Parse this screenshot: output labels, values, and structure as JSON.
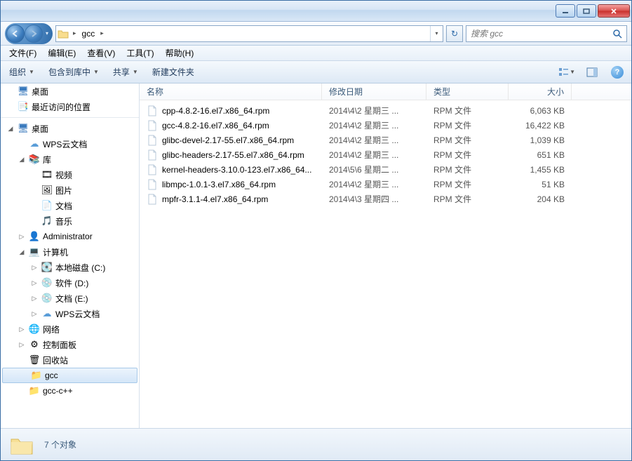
{
  "window": {
    "title_path": "gcc"
  },
  "nav": {
    "address_root_arrow": "▸",
    "address_current": "gcc"
  },
  "search": {
    "placeholder": "搜索 gcc"
  },
  "menus": {
    "file": "文件(F)",
    "edit": "编辑(E)",
    "view": "查看(V)",
    "tools": "工具(T)",
    "help": "帮助(H)"
  },
  "toolbar": {
    "organize": "组织",
    "include": "包含到库中",
    "share": "共享",
    "new_folder": "新建文件夹"
  },
  "columns": {
    "name": "名称",
    "date": "修改日期",
    "type": "类型",
    "size": "大小"
  },
  "sidebar": {
    "desktop1": "桌面",
    "recent": "最近访问的位置",
    "desktop2": "桌面",
    "wps": "WPS云文档",
    "libraries": "库",
    "videos": "视频",
    "pictures": "图片",
    "documents": "文档",
    "music": "音乐",
    "admin": "Administrator",
    "computer": "计算机",
    "drive_c": "本地磁盘 (C:)",
    "drive_d": "软件 (D:)",
    "drive_e": "文档 (E:)",
    "wps2": "WPS云文档",
    "network": "网络",
    "control": "控制面板",
    "recycle": "回收站",
    "gcc": "gcc",
    "gccpp": "gcc-c++"
  },
  "files": [
    {
      "name": "cpp-4.8.2-16.el7.x86_64.rpm",
      "date": "2014\\4\\2 星期三 ...",
      "type": "RPM 文件",
      "size": "6,063 KB"
    },
    {
      "name": "gcc-4.8.2-16.el7.x86_64.rpm",
      "date": "2014\\4\\2 星期三 ...",
      "type": "RPM 文件",
      "size": "16,422 KB"
    },
    {
      "name": "glibc-devel-2.17-55.el7.x86_64.rpm",
      "date": "2014\\4\\2 星期三 ...",
      "type": "RPM 文件",
      "size": "1,039 KB"
    },
    {
      "name": "glibc-headers-2.17-55.el7.x86_64.rpm",
      "date": "2014\\4\\2 星期三 ...",
      "type": "RPM 文件",
      "size": "651 KB"
    },
    {
      "name": "kernel-headers-3.10.0-123.el7.x86_64...",
      "date": "2014\\5\\6 星期二 ...",
      "type": "RPM 文件",
      "size": "1,455 KB"
    },
    {
      "name": "libmpc-1.0.1-3.el7.x86_64.rpm",
      "date": "2014\\4\\2 星期三 ...",
      "type": "RPM 文件",
      "size": "51 KB"
    },
    {
      "name": "mpfr-3.1.1-4.el7.x86_64.rpm",
      "date": "2014\\4\\3 星期四 ...",
      "type": "RPM 文件",
      "size": "204 KB"
    }
  ],
  "status": {
    "count": "7 个对象"
  }
}
